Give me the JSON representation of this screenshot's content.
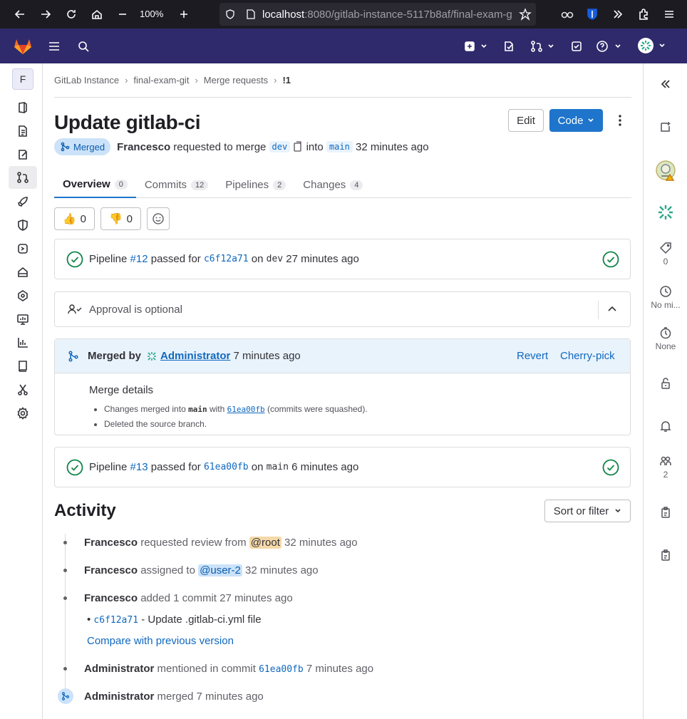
{
  "browser": {
    "zoom": "100%",
    "url_host": "localhost",
    "url_path": ":8080/gitlab-instance-5117b8af/final-exam-g"
  },
  "breadcrumb": [
    "GitLab Instance",
    "final-exam-git",
    "Merge requests",
    "!1"
  ],
  "project_avatar_letter": "F",
  "mr": {
    "title": "Update gitlab-ci",
    "status": "Merged",
    "author": "Francesco",
    "requested_text": "requested to merge",
    "source_branch": "dev",
    "into_text": "into",
    "target_branch": "main",
    "time": "32 minutes ago",
    "edit_label": "Edit",
    "code_label": "Code"
  },
  "tabs": [
    {
      "label": "Overview",
      "count": "0"
    },
    {
      "label": "Commits",
      "count": "12"
    },
    {
      "label": "Pipelines",
      "count": "2"
    },
    {
      "label": "Changes",
      "count": "4"
    }
  ],
  "reactions": {
    "thumbs_up": "0",
    "thumbs_down": "0"
  },
  "pipeline1": {
    "prefix": "Pipeline",
    "id": "#12",
    "passed": "passed for",
    "commit": "c6f12a71",
    "on": "on",
    "branch": "dev",
    "time": "27 minutes ago"
  },
  "approval": {
    "text": "Approval is optional"
  },
  "merged_widget": {
    "merged_by": "Merged by",
    "user": "Administrator",
    "time": "7 minutes ago",
    "revert": "Revert",
    "cherry_pick": "Cherry-pick",
    "details_title": "Merge details",
    "line1_pre": "Changes merged into",
    "line1_branch": "main",
    "line1_with": "with",
    "line1_commit": "61ea00fb",
    "line1_post": "(commits were squashed).",
    "line2": "Deleted the source branch."
  },
  "pipeline2": {
    "prefix": "Pipeline",
    "id": "#13",
    "passed": "passed for",
    "commit": "61ea00fb",
    "on": "on",
    "branch": "main",
    "time": "6 minutes ago"
  },
  "activity": {
    "title": "Activity",
    "sort_label": "Sort or filter",
    "items": [
      {
        "user": "Francesco",
        "text": "requested review from",
        "mention": "@root",
        "time": "32 minutes ago"
      },
      {
        "user": "Francesco",
        "text": "assigned to",
        "mention": "@user-2",
        "time": "32 minutes ago"
      },
      {
        "user": "Francesco",
        "text": "added 1 commit",
        "time": "27 minutes ago",
        "commit_sha": "c6f12a71",
        "commit_msg": "- Update .gitlab-ci.yml file",
        "compare": "Compare with previous version"
      },
      {
        "user": "Administrator",
        "text": "mentioned in commit",
        "commit": "61ea00fb",
        "time": "7 minutes ago"
      },
      {
        "user": "Administrator",
        "text": "merged",
        "time": "7 minutes ago"
      }
    ]
  },
  "right_sidebar": {
    "labels_count": "0",
    "milestone": "No mi...",
    "time_tracking": "None",
    "participants": "2"
  },
  "colors": {
    "top_bar": "#2f2a6b",
    "primary": "#1f75cb",
    "success": "#108548",
    "merged_bg": "#cbe2f9"
  }
}
